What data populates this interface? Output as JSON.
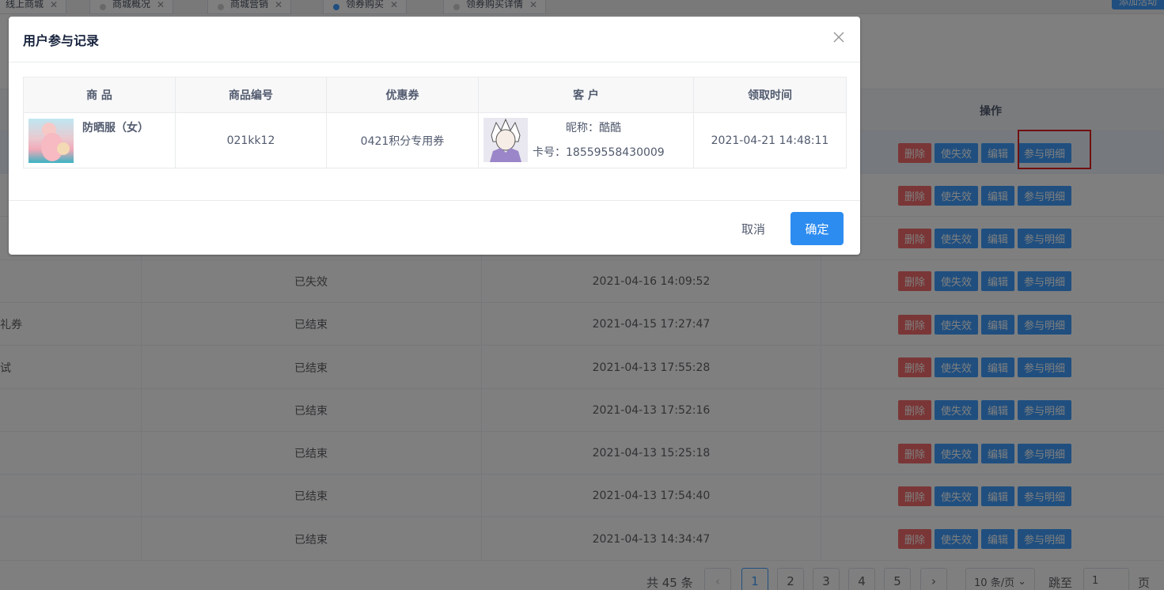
{
  "tabs": [
    {
      "label": "线上商城",
      "active": false
    },
    {
      "label": "商城概况",
      "active": false
    },
    {
      "label": "商城营销",
      "active": false
    },
    {
      "label": "领券购买",
      "active": true
    },
    {
      "label": "领券购买详情",
      "active": false
    }
  ],
  "top_button": "添加活动",
  "table": {
    "op_header": "操作",
    "op_labels": {
      "delete": "删除",
      "invalidate": "使失效",
      "edit": "编辑",
      "detail": "参与明细"
    },
    "rows": [
      {
        "name": "",
        "status": "",
        "time": ""
      },
      {
        "name": "",
        "status": "",
        "time": ""
      },
      {
        "name": "",
        "status": "",
        "time": ""
      },
      {
        "name": "",
        "status": "已失效",
        "time": "2021-04-16 14:09:52"
      },
      {
        "name": "礼券",
        "status": "已结束",
        "time": "2021-04-15 17:27:47"
      },
      {
        "name": "试",
        "status": "已结束",
        "time": "2021-04-13 17:55:28"
      },
      {
        "name": "",
        "status": "已结束",
        "time": "2021-04-13 17:52:16"
      },
      {
        "name": "",
        "status": "已结束",
        "time": "2021-04-13 15:25:18"
      },
      {
        "name": "",
        "status": "已结束",
        "time": "2021-04-13 17:54:40"
      },
      {
        "name": "",
        "status": "已结束",
        "time": "2021-04-13 14:34:47"
      }
    ]
  },
  "pagination": {
    "total": "共 45 条",
    "pages": [
      "1",
      "2",
      "3",
      "4",
      "5"
    ],
    "current": "1",
    "page_size": "10 条/页",
    "jump_label": "跳至",
    "jump_value": "1",
    "page_unit": "页"
  },
  "dialog": {
    "title": "用户参与记录",
    "columns": [
      "商 品",
      "商品编号",
      "优惠券",
      "客 户",
      "领取时间"
    ],
    "record": {
      "goods_name": "防晒服（女）",
      "goods_no": "021kk12",
      "coupon": "0421积分专用券",
      "nickname": "昵称：酷酷",
      "card": "卡号：18559558430009",
      "time": "2021-04-21 14:48:11"
    },
    "cancel": "取消",
    "confirm": "确定"
  }
}
